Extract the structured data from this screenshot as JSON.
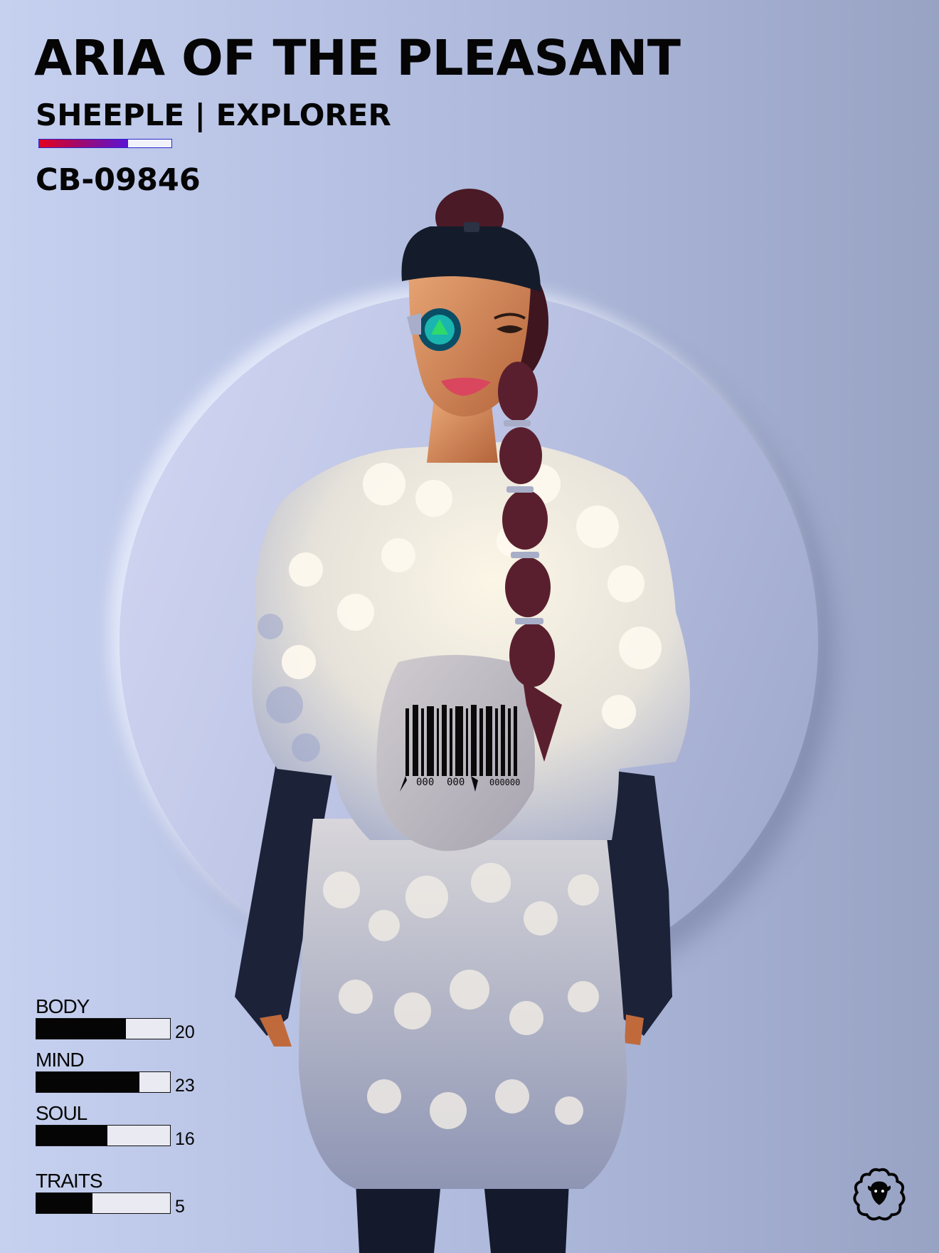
{
  "card": {
    "name": "ARIA OF THE PLEASANT",
    "class_line": "SHEEPLE | EXPLORER",
    "serial": "CB-09846",
    "rarity_fill_fraction": 0.67
  },
  "barcode": {
    "digits": [
      "000",
      "000",
      "000000"
    ]
  },
  "stats": [
    {
      "label": "BODY",
      "value": "20",
      "fill_fraction": 0.67
    },
    {
      "label": "MIND",
      "value": "23",
      "fill_fraction": 0.77
    },
    {
      "label": "SOUL",
      "value": "16",
      "fill_fraction": 0.53
    },
    {
      "label": "TRAITS",
      "value": "5",
      "fill_fraction": 0.42
    }
  ],
  "colors": {
    "background": "#b2bde0",
    "text": "#050505",
    "rarity_start": "#e4001c",
    "rarity_end": "#5a14d4"
  },
  "icons": {
    "logo": "sheep-logo-icon"
  }
}
